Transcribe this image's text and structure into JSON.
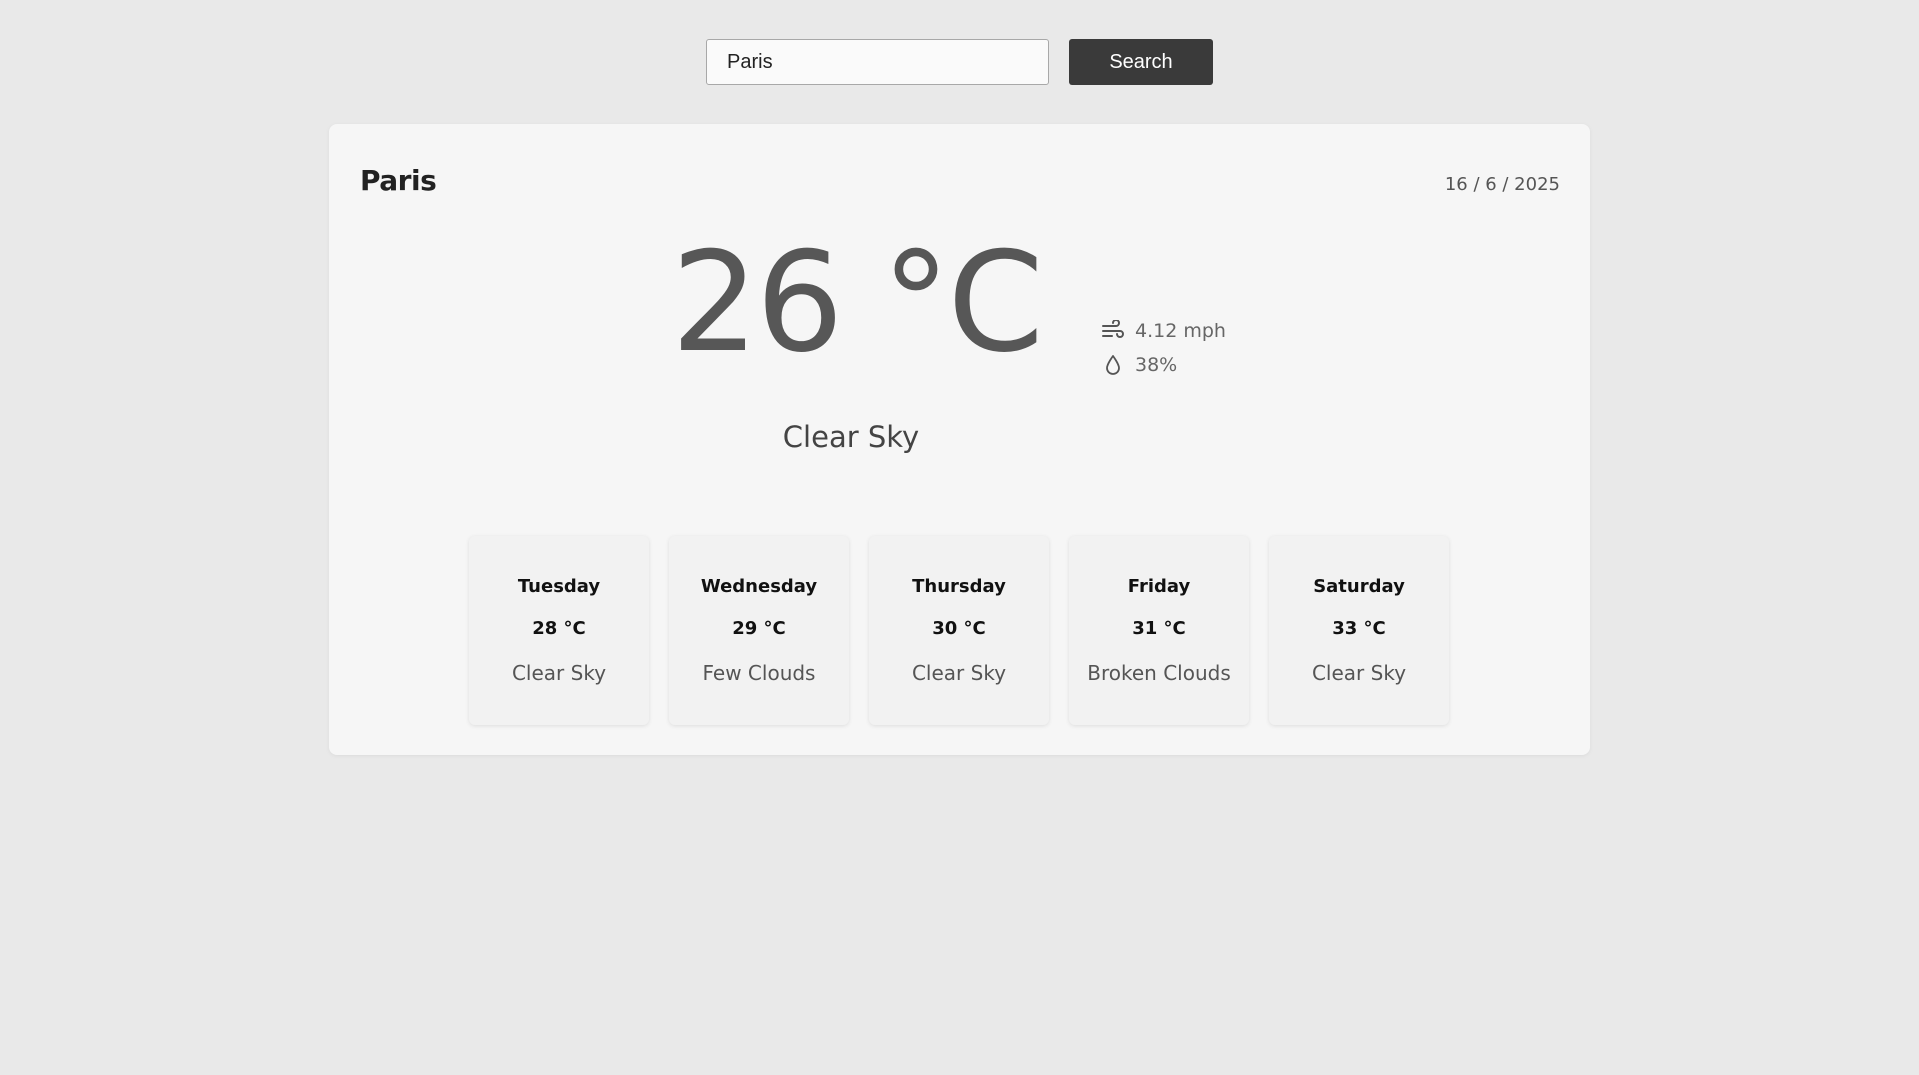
{
  "search": {
    "value": "Paris",
    "placeholder": "",
    "button_label": "Search"
  },
  "current": {
    "city": "Paris",
    "date": "16 / 6 / 2025",
    "temperature": "26 °C",
    "condition": "Clear Sky",
    "wind": "4.12 mph",
    "humidity": "38%"
  },
  "icons": {
    "wind": "wind-icon",
    "humidity": "droplet-icon"
  },
  "forecast": [
    {
      "day": "Tuesday",
      "temp": "28 °C",
      "condition": "Clear Sky"
    },
    {
      "day": "Wednesday",
      "temp": "29 °C",
      "condition": "Few Clouds"
    },
    {
      "day": "Thursday",
      "temp": "30 °C",
      "condition": "Clear Sky"
    },
    {
      "day": "Friday",
      "temp": "31 °C",
      "condition": "Broken Clouds"
    },
    {
      "day": "Saturday",
      "temp": "33 °C",
      "condition": "Clear Sky"
    }
  ],
  "colors": {
    "background": "#e9e9e9",
    "card": "#f6f6f6",
    "button": "#3a3a3a",
    "temperature": "#575757"
  }
}
